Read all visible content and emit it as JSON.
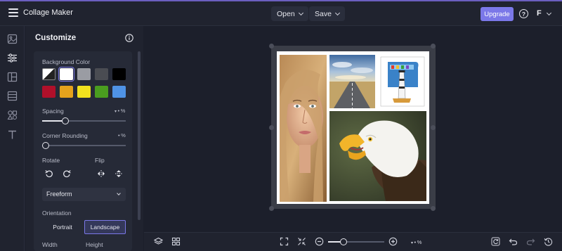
{
  "app": {
    "title": "Collage Maker"
  },
  "topbar": {
    "open_label": "Open",
    "save_label": "Save",
    "upgrade_label": "Upgrade",
    "help_glyph": "?",
    "user_initial": "F"
  },
  "rail": {
    "items": [
      "images-icon",
      "customize-icon",
      "layouts-icon",
      "backgrounds-icon",
      "graphics-icon",
      "text-icon"
    ],
    "active": "customize-icon"
  },
  "panel": {
    "title": "Customize",
    "background_color": {
      "label": "Background Color",
      "swatches": [
        "transparent",
        "#ffffff",
        "#9a9ca3",
        "#4a4c52",
        "#000000",
        "#b0102a",
        "#e5a21c",
        "#f1e11e",
        "#4a9d1f",
        "#4f93e6"
      ],
      "selected": "#ffffff"
    },
    "spacing": {
      "label": "Spacing",
      "unit": "%",
      "level": 0.28
    },
    "corner_rounding": {
      "label": "Corner Rounding",
      "unit": "%",
      "level": 0.0
    },
    "rotate": {
      "label": "Rotate"
    },
    "flip": {
      "label": "Flip"
    },
    "crop_select": {
      "value": "Freeform"
    },
    "orientation": {
      "label": "Orientation",
      "options": [
        "Portrait",
        "Landscape"
      ],
      "selected": "Landscape"
    },
    "width_label": "Width",
    "height_label": "Height"
  },
  "canvas": {
    "photos": [
      "woman-portrait-photo",
      "road-horizon-photo",
      "lighthouse-photo",
      "bald-eagle-photo"
    ],
    "background": "#ffffff"
  },
  "bottombar": {
    "zoom_unit": "%",
    "zoom_level": 0.28
  },
  "colors": {
    "accent": "#7b78e8",
    "bg": "#1c1f2b",
    "panel": "#20232f"
  }
}
